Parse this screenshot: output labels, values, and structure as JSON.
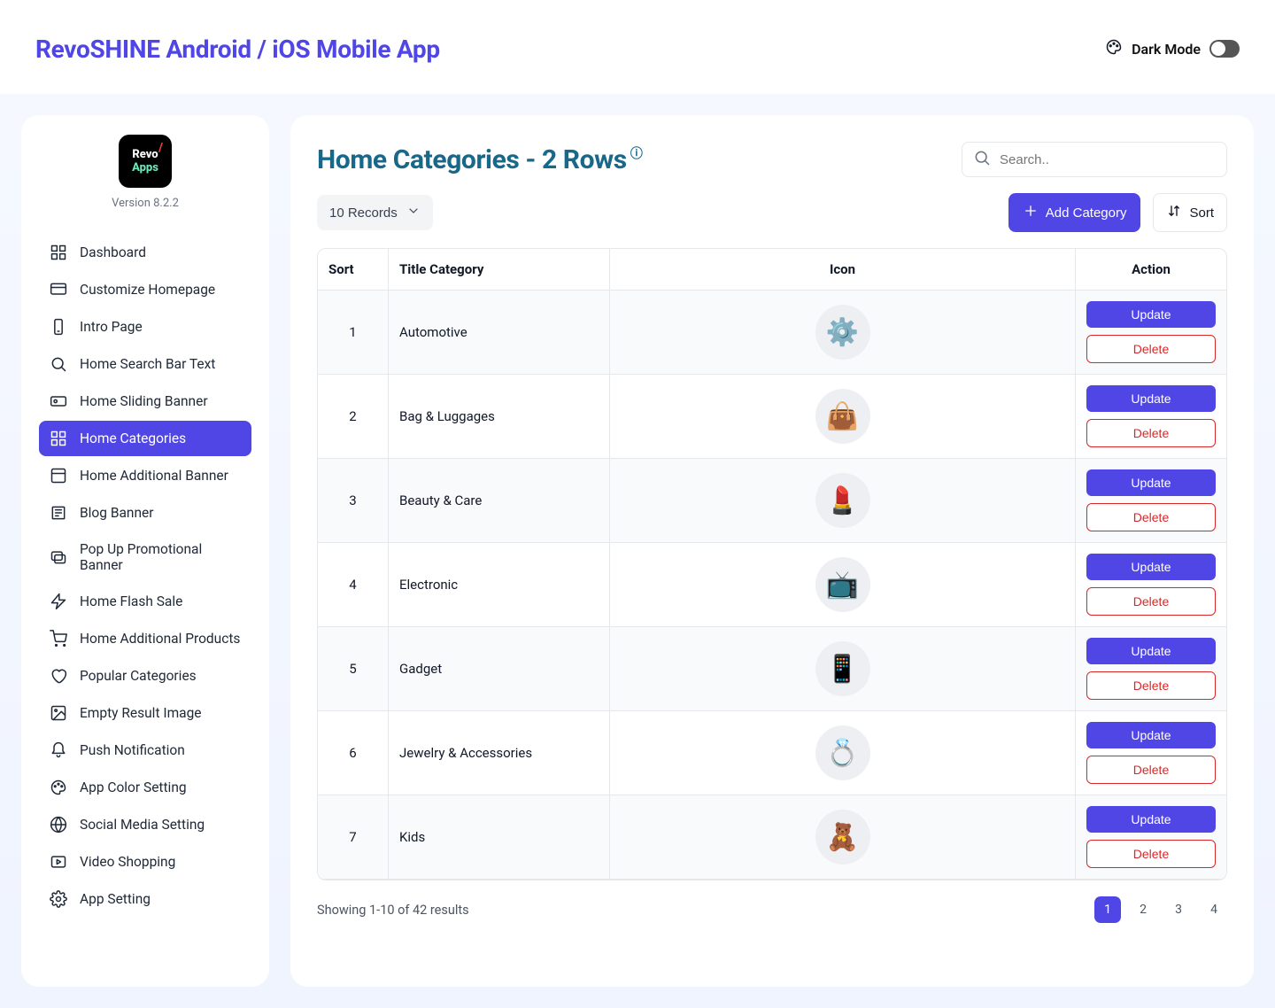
{
  "header": {
    "title": "RevoSHINE Android / iOS Mobile App",
    "dark_mode_label": "Dark Mode"
  },
  "sidebar": {
    "logo_top": "Revo",
    "logo_bot": "Apps",
    "version": "Version 8.2.2",
    "items": [
      "Dashboard",
      "Customize Homepage",
      "Intro Page",
      "Home Search Bar Text",
      "Home Sliding Banner",
      "Home Categories",
      "Home Additional Banner",
      "Blog Banner",
      "Pop Up Promotional Banner",
      "Home Flash Sale",
      "Home Additional Products",
      "Popular Categories",
      "Empty Result Image",
      "Push Notification",
      "App Color Setting",
      "Social Media Setting",
      "Video Shopping",
      "App Setting"
    ],
    "active_index": 5
  },
  "page": {
    "title": "Home Categories - 2 Rows",
    "search_placeholder": "Search..",
    "records_label": "10 Records",
    "add_button": "Add Category",
    "sort_button": "Sort"
  },
  "table": {
    "headers": {
      "sort": "Sort",
      "title": "Title Category",
      "icon": "Icon",
      "action": "Action"
    },
    "update_label": "Update",
    "delete_label": "Delete",
    "rows": [
      {
        "sort": 1,
        "title": "Automotive",
        "emoji": "⚙️"
      },
      {
        "sort": 2,
        "title": "Bag & Luggages",
        "emoji": "👜"
      },
      {
        "sort": 3,
        "title": "Beauty & Care",
        "emoji": "💄"
      },
      {
        "sort": 4,
        "title": "Electronic",
        "emoji": "📺"
      },
      {
        "sort": 5,
        "title": "Gadget",
        "emoji": "📱"
      },
      {
        "sort": 6,
        "title": "Jewelry & Accessories",
        "emoji": "💍"
      },
      {
        "sort": 7,
        "title": "Kids",
        "emoji": "🧸"
      }
    ]
  },
  "footer": {
    "results_text": "Showing 1-10 of 42 results",
    "pages": [
      1,
      2,
      3,
      4
    ],
    "active_page": 1
  }
}
